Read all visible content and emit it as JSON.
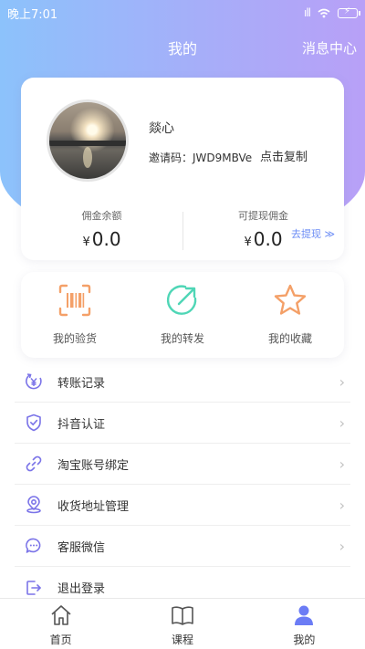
{
  "status_bar": {
    "time": "晚上7:01",
    "signal_text": "ıll",
    "battery_text": "⚡"
  },
  "navbar": {
    "title": "我的",
    "right_action": "消息中心"
  },
  "profile": {
    "username": "燚心",
    "invite_code": "邀请码：JWD9MBVe",
    "copy_label": "点击复制"
  },
  "stats": {
    "commission_label": "佣金余额",
    "commission_currency": "¥",
    "commission_value": "0.0",
    "withdrawable_label": "可提现佣金",
    "withdrawable_currency": "¥",
    "withdrawable_value": "0.0",
    "withdraw_link": "去提现 ≫"
  },
  "quick_actions": [
    {
      "label": "我的验货",
      "icon": "barcode-scan-icon"
    },
    {
      "label": "我的转发",
      "icon": "share-forward-icon"
    },
    {
      "label": "我的收藏",
      "icon": "star-icon"
    }
  ],
  "menu": [
    {
      "label": "转账记录",
      "icon": "yen-refresh-icon"
    },
    {
      "label": "抖音认证",
      "icon": "shield-check-icon"
    },
    {
      "label": "淘宝账号绑定",
      "icon": "link-icon"
    },
    {
      "label": "收货地址管理",
      "icon": "location-icon"
    },
    {
      "label": "客服微信",
      "icon": "chat-bubble-icon"
    },
    {
      "label": "退出登录",
      "icon": "logout-icon"
    }
  ],
  "tabbar": [
    {
      "label": "首页",
      "icon": "home-icon"
    },
    {
      "label": "课程",
      "icon": "book-icon"
    },
    {
      "label": "我的",
      "icon": "user-icon"
    }
  ],
  "colors": {
    "accent": "#6b7cf5",
    "hero_start": "#8cc2fb",
    "hero_end": "#b8a0f7",
    "quick_orange": "#f4a068",
    "quick_green": "#4fd6b6",
    "menu_icon": "#7b74e8"
  }
}
